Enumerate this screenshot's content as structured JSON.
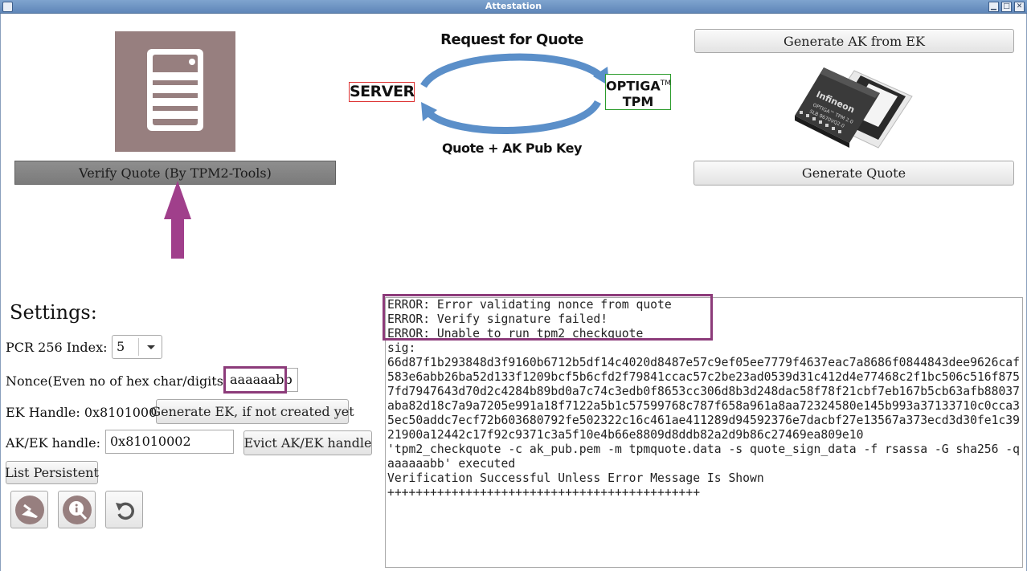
{
  "window": {
    "title": "Attestation",
    "controls": [
      "minimize",
      "maximize",
      "close"
    ]
  },
  "buttons": {
    "verify_quote": "Verify Quote (By TPM2-Tools)",
    "generate_ak": "Generate AK from EK",
    "generate_quote": "Generate Quote",
    "generate_ek": "Generate EK, if not created yet",
    "evict_handle": "Evict AK/EK handle",
    "list_persistent": "List Persistent"
  },
  "diagram": {
    "top_label": "Request for Quote",
    "bottom_label": "Quote + AK Pub Key",
    "left_box": "SERVER",
    "right_box_line1": "OPTIGA",
    "right_box_tm": "TM",
    "right_box_line2": "TPM",
    "chip_brand": "Infineon",
    "chip_line1": "OPTIGA™ TPM 2.0",
    "chip_line2": "SLB 9670VQ2.0"
  },
  "settings": {
    "title": "Settings:",
    "pcr_label": "PCR 256 Index:",
    "pcr_value": "5",
    "nonce_label": "Nonce(Even no of hex char/digits):",
    "nonce_value": "aaaaaabb",
    "ek_handle_label": "EK Handle: 0x81010001",
    "akek_label": "AK/EK handle:",
    "akek_value": "0x81010002"
  },
  "icon_buttons": [
    "clean-icon",
    "info-icon",
    "reset-icon"
  ],
  "output": {
    "errors": "ERROR: Error validating nonce from quote\nERROR: Verify signature failed!\nERROR: Unable to run tpm2_checkquote",
    "log": "sig:\n66d87f1b293848d3f9160b6712b5df14c4020d8487e57c9ef05ee7779f4637eac7a8686f0844843dee9626caf583e6abb26ba52d133f1209bcf5b6cfd2f79841ccac57c2be23ad0539d31c412d4e77468c2f1bc506c516f8757fd7947643d70d2c4284b89bd0a7c74c3edb0f8653cc306d8b3d248dac58f78f21cbf7eb167b5cb63afb88037aba82d18c7a9a7205e991a18f7122a5b1c57599768c787f658a961a8aa72324580e145b993a37133710c0cca35ec50addc7ecf72b603680792fe502322c16c461ae411289d94592376e7dacbf27e13567a373ecd3d30fe1c3921900a12442c17f92c9371c3a5f10e4b66e8809d8ddb82a2d9b86c27469ea809e10\n'tpm2_checkquote -c ak_pub.pem -m tpmquote.data -s quote_sign_data -f rsassa -G sha256 -q aaaaaabb' executed\nVerification Successful Unless Error Message Is Shown\n++++++++++++++++++++++++++++++++++++++++++++"
  },
  "colors": {
    "highlight": "#8c3b7a",
    "server_tile": "#977f7f",
    "server_box_border": "#dd3333",
    "tpm_box_border": "#2c9c2c",
    "diagram_arrow": "#5b8fc9"
  }
}
